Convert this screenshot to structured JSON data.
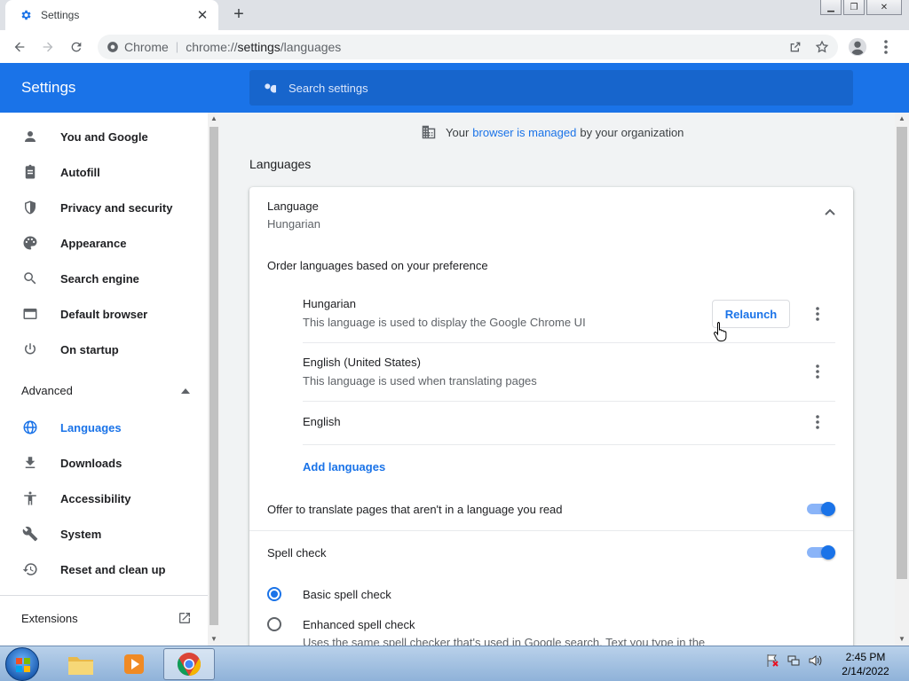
{
  "browser": {
    "tab_title": "Settings",
    "site_chip": "Chrome",
    "url_scheme": "chrome://",
    "url_host": "settings",
    "url_path": "/languages"
  },
  "header": {
    "title": "Settings",
    "search_placeholder": "Search settings"
  },
  "sidebar": {
    "items": [
      {
        "label": "You and Google",
        "icon": "person-icon"
      },
      {
        "label": "Autofill",
        "icon": "clipboard-icon"
      },
      {
        "label": "Privacy and security",
        "icon": "shield-icon"
      },
      {
        "label": "Appearance",
        "icon": "palette-icon"
      },
      {
        "label": "Search engine",
        "icon": "search-icon"
      },
      {
        "label": "Default browser",
        "icon": "browser-window-icon"
      },
      {
        "label": "On startup",
        "icon": "power-icon"
      }
    ],
    "advanced_label": "Advanced",
    "advanced_items": [
      {
        "label": "Languages",
        "icon": "globe-icon",
        "active": true
      },
      {
        "label": "Downloads",
        "icon": "download-icon"
      },
      {
        "label": "Accessibility",
        "icon": "accessibility-icon"
      },
      {
        "label": "System",
        "icon": "wrench-icon"
      },
      {
        "label": "Reset and clean up",
        "icon": "restore-icon"
      }
    ],
    "extensions_label": "Extensions"
  },
  "main": {
    "managed_prefix": "Your",
    "managed_link": "browser is managed",
    "managed_suffix": "by your organization",
    "section_title": "Languages",
    "language_label": "Language",
    "language_value": "Hungarian",
    "order_text": "Order languages based on your preference",
    "languages": [
      {
        "name": "Hungarian",
        "desc": "This language is used to display the Google Chrome UI",
        "relaunch": "Relaunch"
      },
      {
        "name": "English (United States)",
        "desc": "This language is used when translating pages"
      },
      {
        "name": "English",
        "desc": ""
      }
    ],
    "add_languages": "Add languages",
    "offer_translate": "Offer to translate pages that aren't in a language you read",
    "offer_translate_on": true,
    "spell_check": "Spell check",
    "spell_check_on": true,
    "basic_spell": "Basic spell check",
    "enhanced_spell": "Enhanced spell check",
    "enhanced_desc": "Uses the same spell checker that's used in Google search. Text you type in the"
  },
  "taskbar": {
    "time": "2:45 PM",
    "date": "2/14/2022"
  },
  "colors": {
    "accent": "#1a73e8",
    "header_bg": "#1a73e8",
    "search_bg": "#1765cc"
  }
}
